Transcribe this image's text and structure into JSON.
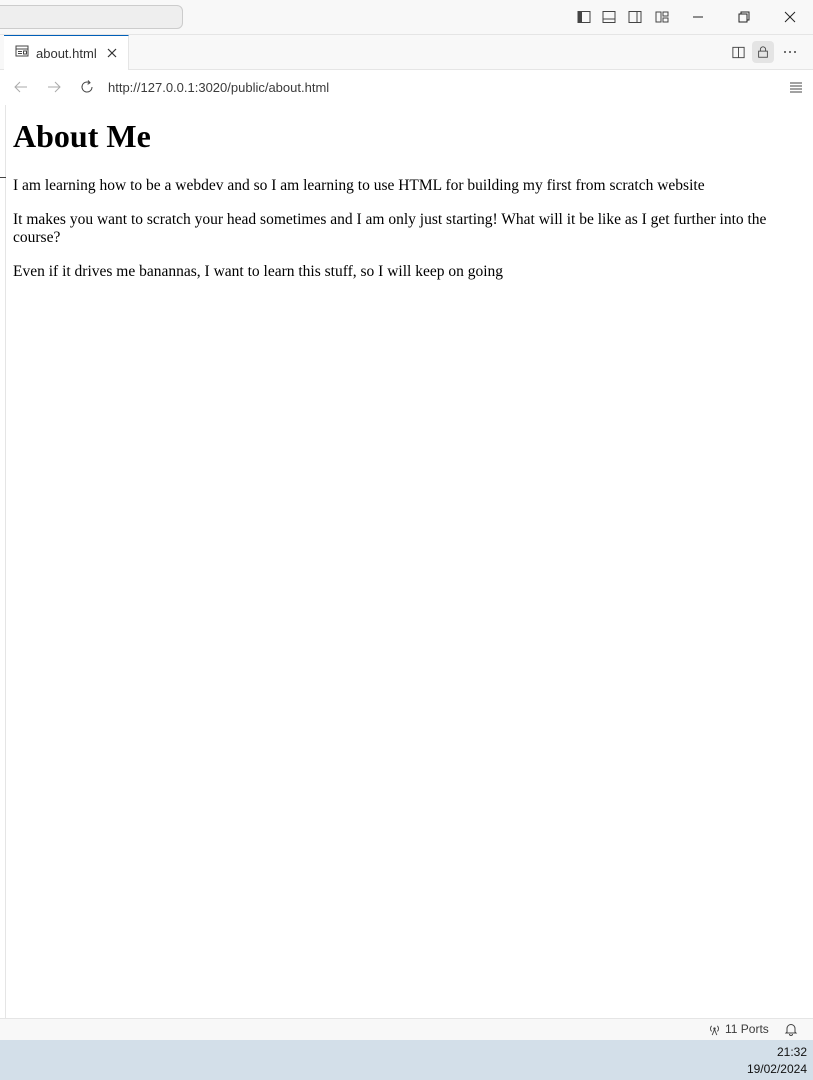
{
  "tab": {
    "title": "about.html"
  },
  "navigation": {
    "url": "http://127.0.0.1:3020/public/about.html"
  },
  "page": {
    "heading": "About Me",
    "paragraphs": [
      "I am learning how to be a webdev and so I am learning to use HTML for building my first from scratch website",
      "It makes you want to scratch your head sometimes and I am only just starting! What will it be like as I get further into the course?",
      "Even if it drives me banannas, I want to learn this stuff, so I will keep on going"
    ]
  },
  "statusbar": {
    "ports": "11 Ports"
  },
  "taskbar": {
    "time": "21:32",
    "date": "19/02/2024"
  },
  "icons": {
    "titlebar": [
      "toggle-primary-sidebar-icon",
      "toggle-panel-icon",
      "toggle-secondary-sidebar-icon",
      "customize-layout-icon",
      "minimize-icon",
      "restore-icon",
      "close-icon"
    ],
    "tabbar": [
      "preview-file-icon",
      "tab-close-icon",
      "split-editor-icon",
      "lock-icon",
      "more-actions-icon"
    ],
    "navbar": [
      "back-icon",
      "forward-icon",
      "reload-icon",
      "menu-icon"
    ]
  },
  "colors": {
    "accent": "#005fb8",
    "taskbar": "#d3dfe9"
  }
}
